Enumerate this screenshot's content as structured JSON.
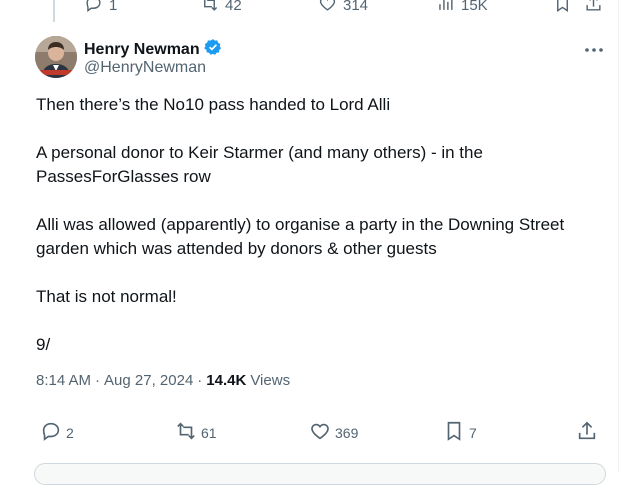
{
  "previous_tweet": {
    "replies": "1",
    "reposts": "42",
    "likes": "314",
    "views": "15K"
  },
  "author": {
    "name": "Henry Newman",
    "handle": "@HenryNewman",
    "verified": true,
    "verified_color": "#1d9bf0"
  },
  "tweet": {
    "paragraphs": [
      "Then there’s the No10 pass handed to Lord Alli",
      "A personal donor to Keir Starmer (and many others) - in the PassesForGlasses row",
      "Alli was allowed (apparently) to organise a party in the Downing Street garden which was attended by donors & other guests",
      "That is not normal!",
      "9/"
    ],
    "time": "8:14 AM",
    "date": "Aug 27, 2024",
    "views_count": "14.4K",
    "views_label": "Views"
  },
  "stats": {
    "replies": "2",
    "reposts": "61",
    "likes": "369",
    "bookmarks": "7"
  },
  "icons": {
    "reply": "reply-icon",
    "repost": "repost-icon",
    "like": "heart-icon",
    "views": "views-icon",
    "bookmark": "bookmark-icon",
    "share": "share-icon",
    "more": "more-icon"
  }
}
